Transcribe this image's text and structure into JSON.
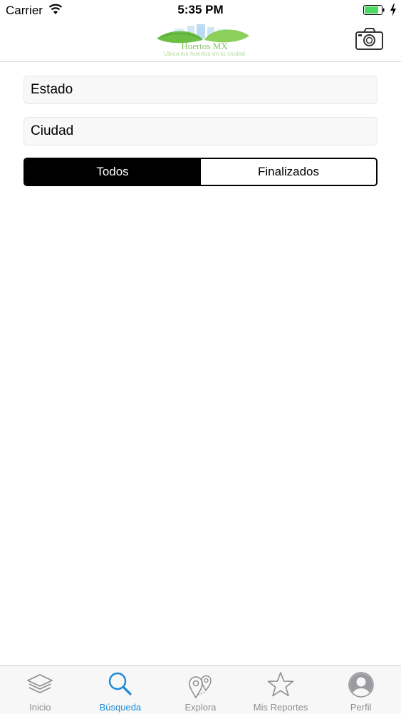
{
  "status_bar": {
    "carrier": "Carrier",
    "time": "5:35 PM"
  },
  "nav": {
    "logo_title": "Huertos MX",
    "logo_subtitle": "Ubica los huertos en tu ciudad",
    "camera_icon": "camera-icon"
  },
  "form": {
    "estado_placeholder": "Estado",
    "ciudad_placeholder": "Ciudad",
    "segments": [
      "Todos",
      "Finalizados"
    ],
    "selected_segment": "Todos"
  },
  "tab_bar": {
    "tabs": [
      {
        "label": "Inicio",
        "icon": "layers-icon"
      },
      {
        "label": "Búsqueda",
        "icon": "search-icon"
      },
      {
        "label": "Explora",
        "icon": "map-pins-icon"
      },
      {
        "label": "Mis Reportes",
        "icon": "star-icon"
      },
      {
        "label": "Perfil",
        "icon": "person-icon"
      }
    ],
    "selected": "Búsqueda"
  },
  "colors": {
    "accent": "#1a8ad6",
    "tab_inactive": "#8e8e93",
    "battery_green": "#4cd964",
    "logo_green": "#6cbf45",
    "logo_blue": "#5aaee0"
  }
}
